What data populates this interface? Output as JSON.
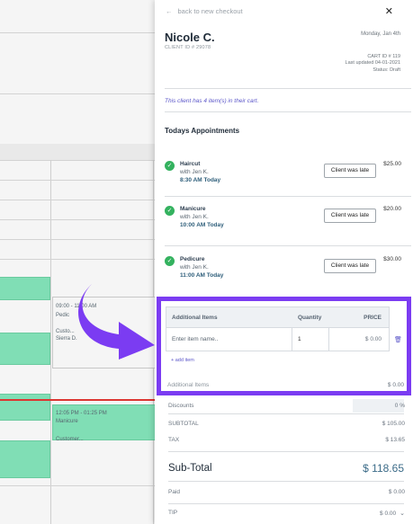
{
  "background": {
    "events": [
      {
        "time": "09:00 - 11:00 AM",
        "lines": [
          "Custo...",
          "Sierra D."
        ]
      },
      {
        "time": "12:05 PM - 01:25 PM",
        "lines": [
          "Manicure",
          "Customer..."
        ]
      }
    ],
    "fragments": [
      "Pedic",
      "Pedic"
    ]
  },
  "panel": {
    "back_label": "back to new checkout",
    "back_icon": "arrow-left-icon",
    "close_icon": "close-icon",
    "client_name": "Nicole C.",
    "client_id": "CLIENT ID # 29078",
    "date": "Monday, Jan 4th",
    "cart_id": "CART ID # 119",
    "last_updated": "Last updated 04-01-2021",
    "status": "Status: Draft",
    "cart_note": "This client has 4 item(s) in their cart.",
    "appointments_title": "Todays Appointments",
    "appointments": [
      {
        "service": "Haircut",
        "with": "with Jen K.",
        "time": "8:30 AM Today",
        "button": "Client was late",
        "price": "$25.00"
      },
      {
        "service": "Manicure",
        "with": "with Jen K.",
        "time": "10:00 AM Today",
        "button": "Client was late",
        "price": "$20.00"
      },
      {
        "service": "Pedicure",
        "with": "with Jen K.",
        "time": "11:00 AM Today",
        "button": "Client was late",
        "price": "$30.00"
      }
    ],
    "items_table": {
      "headers": {
        "name": "Additional Items",
        "qty": "Quantity",
        "price": "PRICE"
      },
      "row": {
        "name_placeholder": "Enter item name..",
        "qty": "1",
        "price": "$ 0.00"
      },
      "add_label": "+ add item",
      "total_label": "Additional Items",
      "total_value": "$ 0.00"
    },
    "summary": {
      "discounts_label": "Discounts",
      "discounts_value": "0 %",
      "subtotal_label": "SUBTOTAL",
      "subtotal_value": "$ 105.00",
      "tax_label": "TAX",
      "tax_value": "$ 13.65",
      "big_label": "Sub-Total",
      "big_value": "$ 118.65",
      "paid_label": "Paid",
      "paid_value": "$ 0.00",
      "tip_label": "TIP",
      "tip_value": "$ 0.00"
    },
    "colors": {
      "highlight": "#7b3cf2",
      "check": "#34b25f",
      "event_green": "#86e8bd",
      "link": "#5b56c9"
    }
  }
}
